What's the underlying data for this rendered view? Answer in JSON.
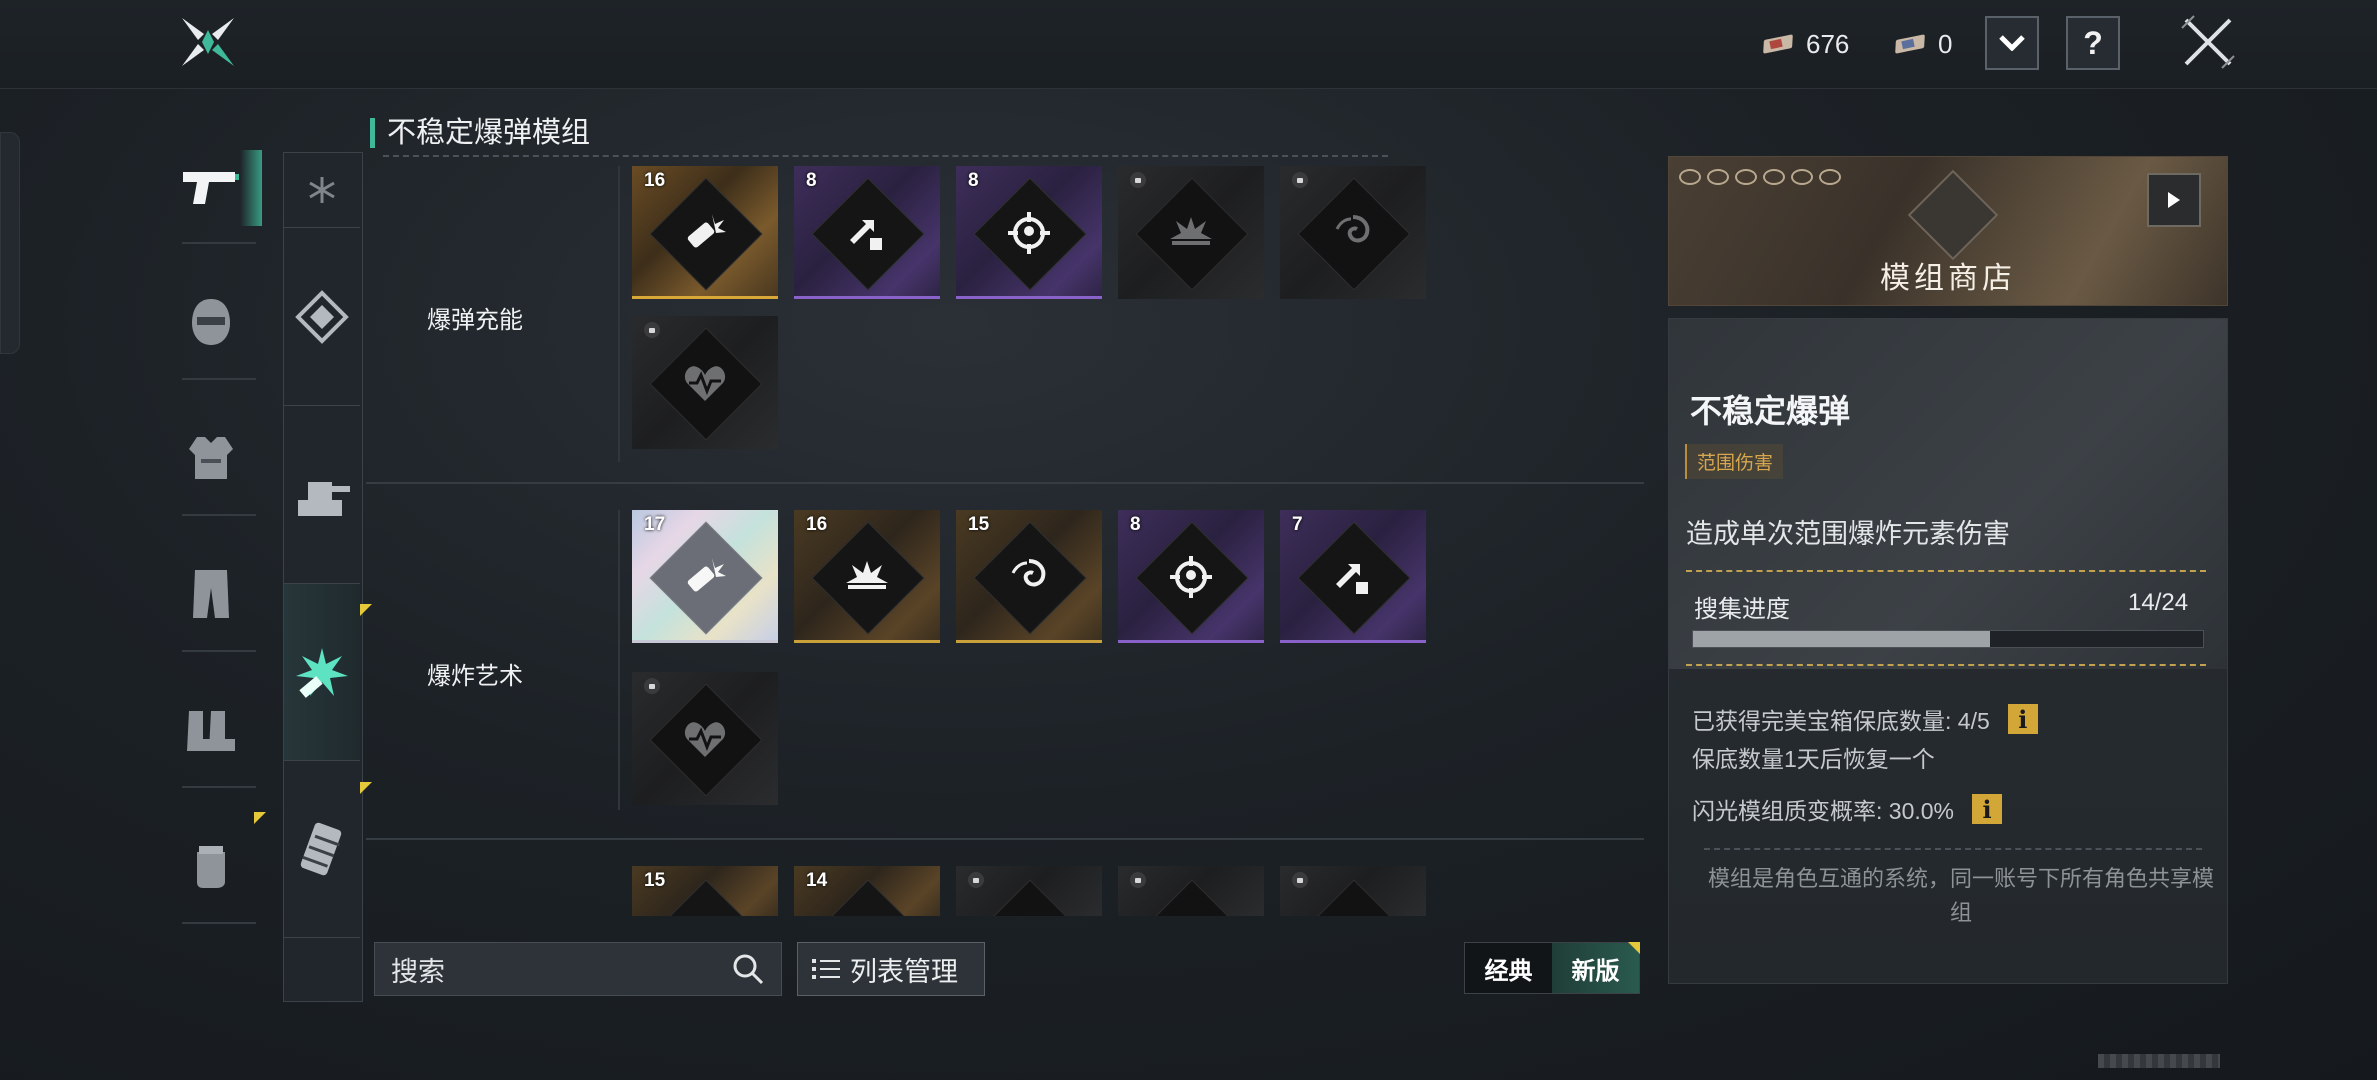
{
  "currencies": [
    {
      "icon": "red-ticket-icon",
      "value": "676"
    },
    {
      "icon": "blue-ticket-icon",
      "value": "0"
    }
  ],
  "topbar": {
    "dropdown_icon": "chevron-down-icon",
    "help_label": "?",
    "close_icon": "close-icon"
  },
  "categories": [
    "pistol-icon",
    "helmet-icon",
    "armor-vest-icon",
    "pants-icon",
    "boots-icon",
    "glove-icon"
  ],
  "section_title": "不稳定爆弹模组",
  "rows": [
    {
      "label": "爆弹充能",
      "cards": [
        {
          "count": "16",
          "rarity": "gold",
          "icon": "explosive-charge-icon"
        },
        {
          "count": "8",
          "rarity": "purple",
          "icon": "shatter-arrow-icon"
        },
        {
          "count": "8",
          "rarity": "purple",
          "icon": "target-crosshair-icon"
        },
        {
          "count": "",
          "rarity": "locked",
          "icon": "explosion-icon"
        },
        {
          "count": "",
          "rarity": "locked",
          "icon": "vortex-icon"
        },
        {
          "count": "",
          "rarity": "locked",
          "icon": "heart-pulse-icon"
        }
      ]
    },
    {
      "label": "爆炸艺术",
      "cards": [
        {
          "count": "17",
          "rarity": "rainbow",
          "icon": "explosive-charge-icon"
        },
        {
          "count": "16",
          "rarity": "gold",
          "icon": "explosion-icon"
        },
        {
          "count": "15",
          "rarity": "gold",
          "icon": "vortex-icon"
        },
        {
          "count": "8",
          "rarity": "purple",
          "icon": "target-crosshair-icon"
        },
        {
          "count": "7",
          "rarity": "purple",
          "icon": "shatter-arrow-icon"
        },
        {
          "count": "",
          "rarity": "locked",
          "icon": "heart-pulse-icon"
        }
      ]
    },
    {
      "label": "",
      "cards": [
        {
          "count": "15",
          "rarity": "gold",
          "icon": ""
        },
        {
          "count": "14",
          "rarity": "gold",
          "icon": ""
        },
        {
          "count": "",
          "rarity": "locked",
          "icon": ""
        },
        {
          "count": "",
          "rarity": "locked",
          "icon": ""
        },
        {
          "count": "",
          "rarity": "locked",
          "icon": ""
        }
      ]
    }
  ],
  "search": {
    "placeholder": "搜索"
  },
  "list_manage": "列表管理",
  "mode": {
    "classic": "经典",
    "new": "新版",
    "selected": "新版"
  },
  "shop": {
    "label": "模组商店"
  },
  "module": {
    "name": "不稳定爆弹",
    "tag": "范围伤害",
    "description": "造成单次范围爆炸元素伤害",
    "progress_label": "搜集进度",
    "progress_value": "14/24",
    "progress_fraction": 0.583,
    "pity_text": "已获得完美宝箱保底数量: 4/5",
    "recover_text": "保底数量1天后恢复一个",
    "flash_text": "闪光模组质变概率: 30.0%",
    "note": "模组是角色互通的系统，同一账号下所有角色共享模组"
  },
  "colors": {
    "accent": "#3fb99a",
    "gold": "#d8a738",
    "purple": "#8862c8",
    "info_button": "#d2a738"
  }
}
